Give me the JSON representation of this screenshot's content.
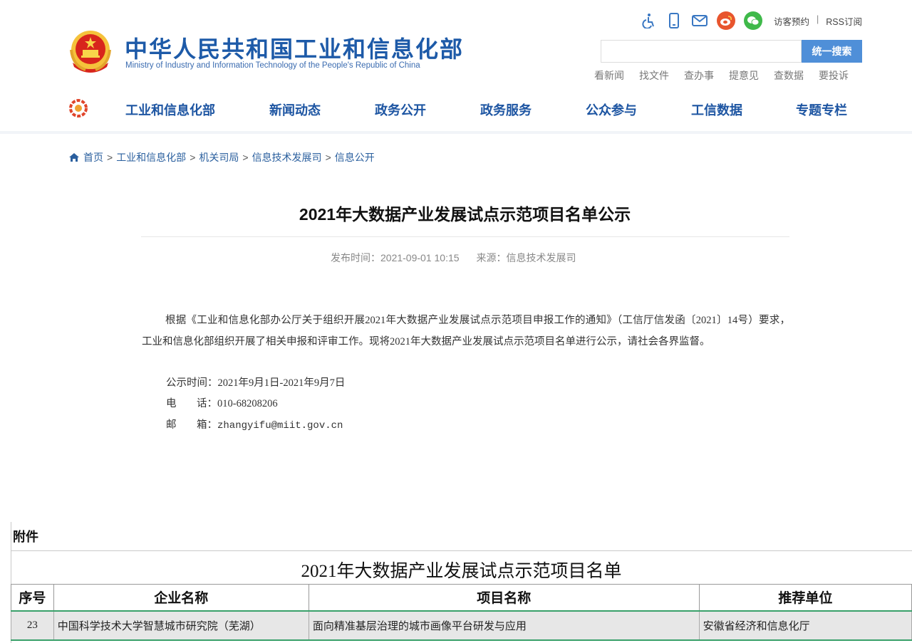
{
  "header": {
    "site_title": "中华人民共和国工业和信息化部",
    "site_subtitle": "Ministry of Industry and Information Technology of the People's Republic of China",
    "top_links": [
      "访客预约",
      "|",
      "RSS订阅"
    ],
    "search_placeholder": "",
    "search_button": "统一搜索",
    "quick_links": [
      "看新闻",
      "找文件",
      "查办事",
      "提意见",
      "查数据",
      "要投诉"
    ],
    "icons": [
      "accessibility-icon",
      "mobile-icon",
      "mail-icon",
      "weibo-icon",
      "wechat-icon"
    ],
    "nav": [
      "工业和信息化部",
      "新闻动态",
      "政务公开",
      "政务服务",
      "公众参与",
      "工信数据",
      "专题专栏"
    ]
  },
  "breadcrumb": [
    "首页",
    "工业和信息化部",
    "机关司局",
    "信息技术发展司",
    "信息公开"
  ],
  "article": {
    "title": "2021年大数据产业发展试点示范项目名单公示",
    "publish_time": "发布时间：2021-09-01 10:15",
    "source": "来源：信息技术发展司",
    "paragraph": "根据《工业和信息化部办公厅关于组织开展2021年大数据产业发展试点示范项目申报工作的通知》（工信厅信发函〔2021〕14号）要求，工业和信息化部组织开展了相关申报和评审工作。现将2021年大数据产业发展试点示范项目名单进行公示，请社会各界监督。",
    "period_label": "公示时间：",
    "period_value": "2021年9月1日-2021年9月7日",
    "phone_label_1": "电",
    "phone_label_2": "话：",
    "phone_value": "010-68208206",
    "email_label_1": "邮",
    "email_label_2": "箱：",
    "email_value": "zhangyifu@miit.gov.cn"
  },
  "attachment": {
    "label": "附件",
    "sheet_title": "2021年大数据产业发展试点示范项目名单",
    "columns": [
      "序号",
      "企业名称",
      "项目名称",
      "推荐单位"
    ],
    "rows": [
      [
        "23",
        "中国科学技术大学智慧城市研究院（芜湖）",
        "面向精准基层治理的城市画像平台研发与应用",
        "安徽省经济和信息化厅"
      ]
    ]
  },
  "colors": {
    "brand_blue": "#1d5aa8",
    "search_button": "#4f8fd8",
    "row_highlight": "#39a06a"
  }
}
